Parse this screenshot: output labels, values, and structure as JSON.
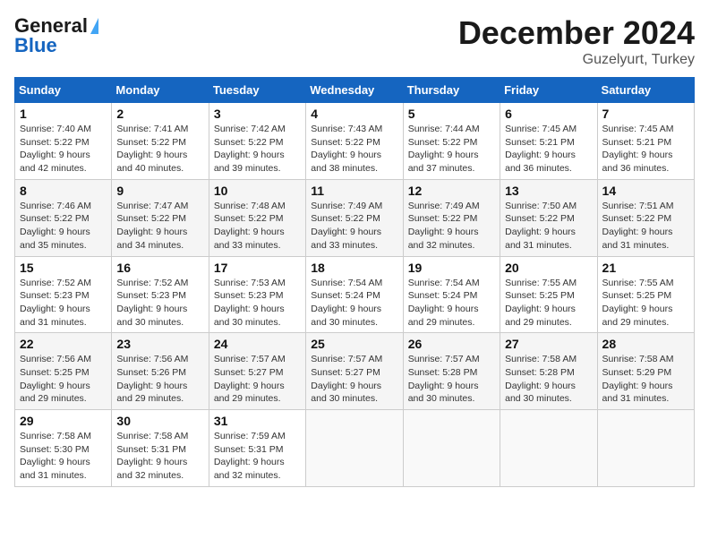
{
  "header": {
    "logo_line1": "General",
    "logo_line2": "Blue",
    "month_title": "December 2024",
    "location": "Guzelyurt, Turkey"
  },
  "weekdays": [
    "Sunday",
    "Monday",
    "Tuesday",
    "Wednesday",
    "Thursday",
    "Friday",
    "Saturday"
  ],
  "weeks": [
    [
      {
        "day": 1,
        "sunrise": "7:40 AM",
        "sunset": "5:22 PM",
        "daylight": "9 hours and 42 minutes."
      },
      {
        "day": 2,
        "sunrise": "7:41 AM",
        "sunset": "5:22 PM",
        "daylight": "9 hours and 40 minutes."
      },
      {
        "day": 3,
        "sunrise": "7:42 AM",
        "sunset": "5:22 PM",
        "daylight": "9 hours and 39 minutes."
      },
      {
        "day": 4,
        "sunrise": "7:43 AM",
        "sunset": "5:22 PM",
        "daylight": "9 hours and 38 minutes."
      },
      {
        "day": 5,
        "sunrise": "7:44 AM",
        "sunset": "5:22 PM",
        "daylight": "9 hours and 37 minutes."
      },
      {
        "day": 6,
        "sunrise": "7:45 AM",
        "sunset": "5:21 PM",
        "daylight": "9 hours and 36 minutes."
      },
      {
        "day": 7,
        "sunrise": "7:45 AM",
        "sunset": "5:21 PM",
        "daylight": "9 hours and 36 minutes."
      }
    ],
    [
      {
        "day": 8,
        "sunrise": "7:46 AM",
        "sunset": "5:22 PM",
        "daylight": "9 hours and 35 minutes."
      },
      {
        "day": 9,
        "sunrise": "7:47 AM",
        "sunset": "5:22 PM",
        "daylight": "9 hours and 34 minutes."
      },
      {
        "day": 10,
        "sunrise": "7:48 AM",
        "sunset": "5:22 PM",
        "daylight": "9 hours and 33 minutes."
      },
      {
        "day": 11,
        "sunrise": "7:49 AM",
        "sunset": "5:22 PM",
        "daylight": "9 hours and 33 minutes."
      },
      {
        "day": 12,
        "sunrise": "7:49 AM",
        "sunset": "5:22 PM",
        "daylight": "9 hours and 32 minutes."
      },
      {
        "day": 13,
        "sunrise": "7:50 AM",
        "sunset": "5:22 PM",
        "daylight": "9 hours and 31 minutes."
      },
      {
        "day": 14,
        "sunrise": "7:51 AM",
        "sunset": "5:22 PM",
        "daylight": "9 hours and 31 minutes."
      }
    ],
    [
      {
        "day": 15,
        "sunrise": "7:52 AM",
        "sunset": "5:23 PM",
        "daylight": "9 hours and 31 minutes."
      },
      {
        "day": 16,
        "sunrise": "7:52 AM",
        "sunset": "5:23 PM",
        "daylight": "9 hours and 30 minutes."
      },
      {
        "day": 17,
        "sunrise": "7:53 AM",
        "sunset": "5:23 PM",
        "daylight": "9 hours and 30 minutes."
      },
      {
        "day": 18,
        "sunrise": "7:54 AM",
        "sunset": "5:24 PM",
        "daylight": "9 hours and 30 minutes."
      },
      {
        "day": 19,
        "sunrise": "7:54 AM",
        "sunset": "5:24 PM",
        "daylight": "9 hours and 29 minutes."
      },
      {
        "day": 20,
        "sunrise": "7:55 AM",
        "sunset": "5:25 PM",
        "daylight": "9 hours and 29 minutes."
      },
      {
        "day": 21,
        "sunrise": "7:55 AM",
        "sunset": "5:25 PM",
        "daylight": "9 hours and 29 minutes."
      }
    ],
    [
      {
        "day": 22,
        "sunrise": "7:56 AM",
        "sunset": "5:25 PM",
        "daylight": "9 hours and 29 minutes."
      },
      {
        "day": 23,
        "sunrise": "7:56 AM",
        "sunset": "5:26 PM",
        "daylight": "9 hours and 29 minutes."
      },
      {
        "day": 24,
        "sunrise": "7:57 AM",
        "sunset": "5:27 PM",
        "daylight": "9 hours and 29 minutes."
      },
      {
        "day": 25,
        "sunrise": "7:57 AM",
        "sunset": "5:27 PM",
        "daylight": "9 hours and 30 minutes."
      },
      {
        "day": 26,
        "sunrise": "7:57 AM",
        "sunset": "5:28 PM",
        "daylight": "9 hours and 30 minutes."
      },
      {
        "day": 27,
        "sunrise": "7:58 AM",
        "sunset": "5:28 PM",
        "daylight": "9 hours and 30 minutes."
      },
      {
        "day": 28,
        "sunrise": "7:58 AM",
        "sunset": "5:29 PM",
        "daylight": "9 hours and 31 minutes."
      }
    ],
    [
      {
        "day": 29,
        "sunrise": "7:58 AM",
        "sunset": "5:30 PM",
        "daylight": "9 hours and 31 minutes."
      },
      {
        "day": 30,
        "sunrise": "7:58 AM",
        "sunset": "5:31 PM",
        "daylight": "9 hours and 32 minutes."
      },
      {
        "day": 31,
        "sunrise": "7:59 AM",
        "sunset": "5:31 PM",
        "daylight": "9 hours and 32 minutes."
      },
      null,
      null,
      null,
      null
    ]
  ]
}
